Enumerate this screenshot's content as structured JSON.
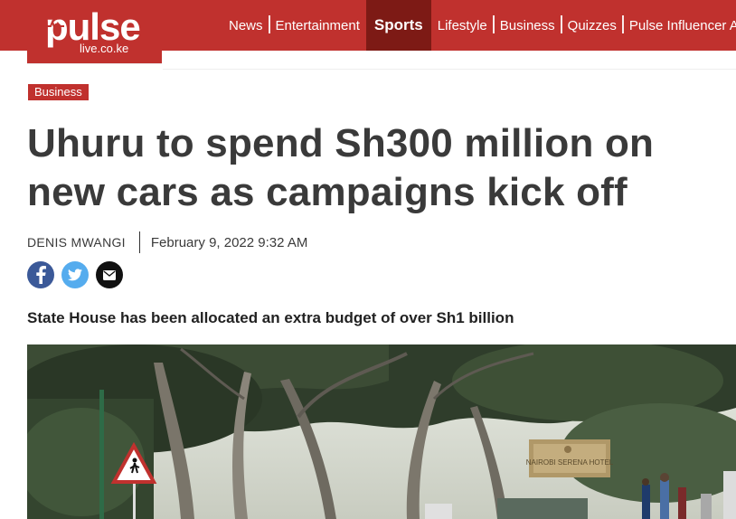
{
  "header": {
    "logo_word": "pulse",
    "logo_sub": "live.co.ke",
    "brand_color": "#c0312e",
    "active_color": "#7d1a15",
    "nav": [
      {
        "label": "News",
        "active": false
      },
      {
        "label": "Entertainment",
        "active": false
      },
      {
        "label": "Sports",
        "active": true
      },
      {
        "label": "Lifestyle",
        "active": false
      },
      {
        "label": "Business",
        "active": false
      },
      {
        "label": "Quizzes",
        "active": false
      },
      {
        "label": "Pulse Influencer Awa",
        "active": false
      }
    ]
  },
  "article": {
    "category": "Business",
    "headline_line1": "Uhuru to spend Sh300 million on",
    "headline_line2": "new cars as campaigns kick off",
    "author": "DENIS MWANGI",
    "date": "February 9, 2022 9:32 AM",
    "summary": "State House has been allocated an extra budget of over Sh1 billion",
    "share": [
      {
        "name": "facebook-icon",
        "color": "#3b5998"
      },
      {
        "name": "twitter-icon",
        "color": "#55acee"
      },
      {
        "name": "email-icon",
        "color": "#111111"
      }
    ]
  },
  "hero_image": {
    "sign_text": "NAIROBI SERENA HOTEL"
  }
}
